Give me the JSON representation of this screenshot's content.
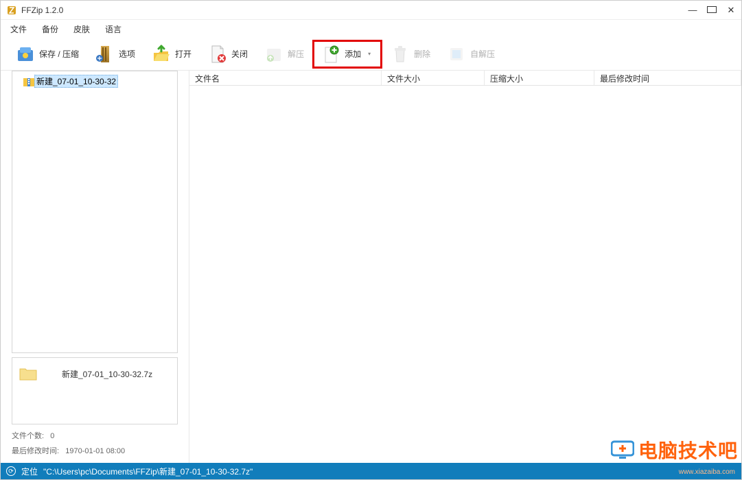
{
  "window": {
    "title": "FFZip 1.2.0"
  },
  "menu": {
    "file": "文件",
    "backup": "备份",
    "skin": "皮肤",
    "language": "语言"
  },
  "toolbar": {
    "save": "保存 / 压缩",
    "options": "选项",
    "open": "打开",
    "close": "关闭",
    "extract": "解压",
    "add": "添加",
    "delete": "删除",
    "selfextract": "自解压"
  },
  "tree": {
    "items": [
      {
        "label": "新建_07-01_10-30-32"
      }
    ]
  },
  "info": {
    "filename": "新建_07-01_10-30-32.7z",
    "file_count_label": "文件个数:",
    "file_count_value": "0",
    "mtime_label": "最后修改时间:",
    "mtime_value": "1970-01-01 08:00"
  },
  "columns": {
    "name": "文件名",
    "size": "文件大小",
    "compressed": "压缩大小",
    "mtime": "最后修改时间"
  },
  "status": {
    "label": "定位",
    "path": "\"C:\\Users\\pc\\Documents\\FFZip\\新建_07-01_10-30-32.7z\""
  },
  "watermark": {
    "text": "电脑技术吧",
    "sub": "www.xiazaiba.com"
  }
}
